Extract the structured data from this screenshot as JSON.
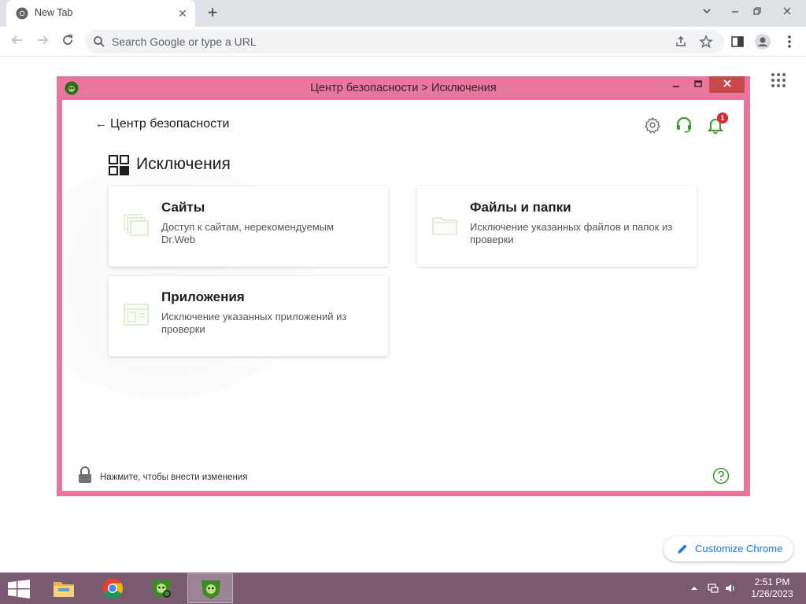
{
  "browser": {
    "tab_title": "New Tab",
    "tab_close": "✕",
    "new_tab": "+",
    "omnibox_placeholder": "Search Google or type a URL"
  },
  "drweb": {
    "window_title": "Центр безопасности > Исключения",
    "back_label": "Центр безопасности",
    "section_title": "Исключения",
    "notification_count": "1",
    "cards": [
      {
        "title": "Сайты",
        "desc": "Доступ к сайтам, нерекомендуемым Dr.Web"
      },
      {
        "title": "Файлы и папки",
        "desc": "Исключение указанных файлов и папок из проверки"
      },
      {
        "title": "Приложения",
        "desc": "Исключение указанных приложений из проверки"
      }
    ],
    "lock_text": "Нажмите, чтобы внести изменения"
  },
  "customize": {
    "label": "Customize Chrome"
  },
  "taskbar": {
    "time": "2:51 PM",
    "date": "1/26/2023"
  },
  "colors": {
    "window_frame": "#e8769e",
    "close_button": "#c74a4a",
    "accent_green": "#3d9b2f",
    "badge_red": "#d9272e",
    "taskbar": "#7a5a6f",
    "chrome_blue": "#1a73e8"
  }
}
